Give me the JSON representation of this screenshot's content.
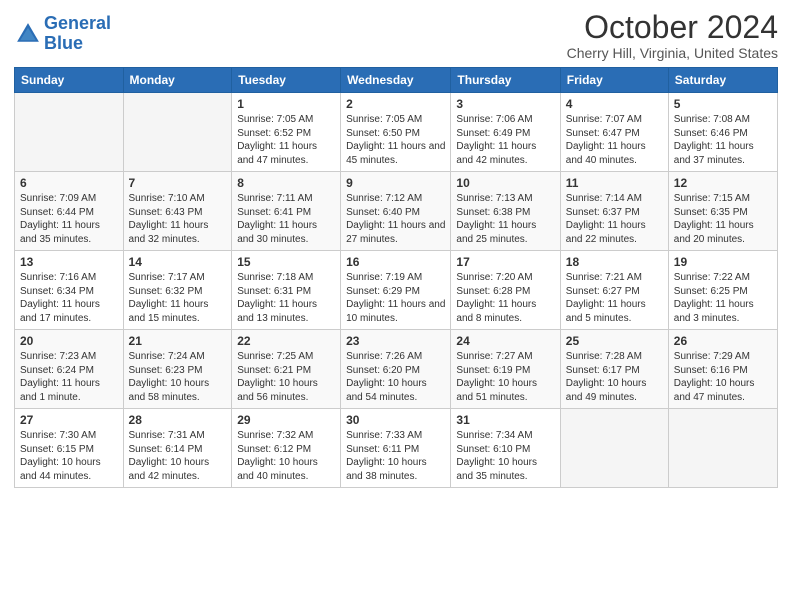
{
  "header": {
    "logo_general": "General",
    "logo_blue": "Blue",
    "month_title": "October 2024",
    "location": "Cherry Hill, Virginia, United States"
  },
  "weekdays": [
    "Sunday",
    "Monday",
    "Tuesday",
    "Wednesday",
    "Thursday",
    "Friday",
    "Saturday"
  ],
  "weeks": [
    [
      {
        "day": "",
        "info": ""
      },
      {
        "day": "",
        "info": ""
      },
      {
        "day": "1",
        "info": "Sunrise: 7:05 AM\nSunset: 6:52 PM\nDaylight: 11 hours and 47 minutes."
      },
      {
        "day": "2",
        "info": "Sunrise: 7:05 AM\nSunset: 6:50 PM\nDaylight: 11 hours and 45 minutes."
      },
      {
        "day": "3",
        "info": "Sunrise: 7:06 AM\nSunset: 6:49 PM\nDaylight: 11 hours and 42 minutes."
      },
      {
        "day": "4",
        "info": "Sunrise: 7:07 AM\nSunset: 6:47 PM\nDaylight: 11 hours and 40 minutes."
      },
      {
        "day": "5",
        "info": "Sunrise: 7:08 AM\nSunset: 6:46 PM\nDaylight: 11 hours and 37 minutes."
      }
    ],
    [
      {
        "day": "6",
        "info": "Sunrise: 7:09 AM\nSunset: 6:44 PM\nDaylight: 11 hours and 35 minutes."
      },
      {
        "day": "7",
        "info": "Sunrise: 7:10 AM\nSunset: 6:43 PM\nDaylight: 11 hours and 32 minutes."
      },
      {
        "day": "8",
        "info": "Sunrise: 7:11 AM\nSunset: 6:41 PM\nDaylight: 11 hours and 30 minutes."
      },
      {
        "day": "9",
        "info": "Sunrise: 7:12 AM\nSunset: 6:40 PM\nDaylight: 11 hours and 27 minutes."
      },
      {
        "day": "10",
        "info": "Sunrise: 7:13 AM\nSunset: 6:38 PM\nDaylight: 11 hours and 25 minutes."
      },
      {
        "day": "11",
        "info": "Sunrise: 7:14 AM\nSunset: 6:37 PM\nDaylight: 11 hours and 22 minutes."
      },
      {
        "day": "12",
        "info": "Sunrise: 7:15 AM\nSunset: 6:35 PM\nDaylight: 11 hours and 20 minutes."
      }
    ],
    [
      {
        "day": "13",
        "info": "Sunrise: 7:16 AM\nSunset: 6:34 PM\nDaylight: 11 hours and 17 minutes."
      },
      {
        "day": "14",
        "info": "Sunrise: 7:17 AM\nSunset: 6:32 PM\nDaylight: 11 hours and 15 minutes."
      },
      {
        "day": "15",
        "info": "Sunrise: 7:18 AM\nSunset: 6:31 PM\nDaylight: 11 hours and 13 minutes."
      },
      {
        "day": "16",
        "info": "Sunrise: 7:19 AM\nSunset: 6:29 PM\nDaylight: 11 hours and 10 minutes."
      },
      {
        "day": "17",
        "info": "Sunrise: 7:20 AM\nSunset: 6:28 PM\nDaylight: 11 hours and 8 minutes."
      },
      {
        "day": "18",
        "info": "Sunrise: 7:21 AM\nSunset: 6:27 PM\nDaylight: 11 hours and 5 minutes."
      },
      {
        "day": "19",
        "info": "Sunrise: 7:22 AM\nSunset: 6:25 PM\nDaylight: 11 hours and 3 minutes."
      }
    ],
    [
      {
        "day": "20",
        "info": "Sunrise: 7:23 AM\nSunset: 6:24 PM\nDaylight: 11 hours and 1 minute."
      },
      {
        "day": "21",
        "info": "Sunrise: 7:24 AM\nSunset: 6:23 PM\nDaylight: 10 hours and 58 minutes."
      },
      {
        "day": "22",
        "info": "Sunrise: 7:25 AM\nSunset: 6:21 PM\nDaylight: 10 hours and 56 minutes."
      },
      {
        "day": "23",
        "info": "Sunrise: 7:26 AM\nSunset: 6:20 PM\nDaylight: 10 hours and 54 minutes."
      },
      {
        "day": "24",
        "info": "Sunrise: 7:27 AM\nSunset: 6:19 PM\nDaylight: 10 hours and 51 minutes."
      },
      {
        "day": "25",
        "info": "Sunrise: 7:28 AM\nSunset: 6:17 PM\nDaylight: 10 hours and 49 minutes."
      },
      {
        "day": "26",
        "info": "Sunrise: 7:29 AM\nSunset: 6:16 PM\nDaylight: 10 hours and 47 minutes."
      }
    ],
    [
      {
        "day": "27",
        "info": "Sunrise: 7:30 AM\nSunset: 6:15 PM\nDaylight: 10 hours and 44 minutes."
      },
      {
        "day": "28",
        "info": "Sunrise: 7:31 AM\nSunset: 6:14 PM\nDaylight: 10 hours and 42 minutes."
      },
      {
        "day": "29",
        "info": "Sunrise: 7:32 AM\nSunset: 6:12 PM\nDaylight: 10 hours and 40 minutes."
      },
      {
        "day": "30",
        "info": "Sunrise: 7:33 AM\nSunset: 6:11 PM\nDaylight: 10 hours and 38 minutes."
      },
      {
        "day": "31",
        "info": "Sunrise: 7:34 AM\nSunset: 6:10 PM\nDaylight: 10 hours and 35 minutes."
      },
      {
        "day": "",
        "info": ""
      },
      {
        "day": "",
        "info": ""
      }
    ]
  ]
}
